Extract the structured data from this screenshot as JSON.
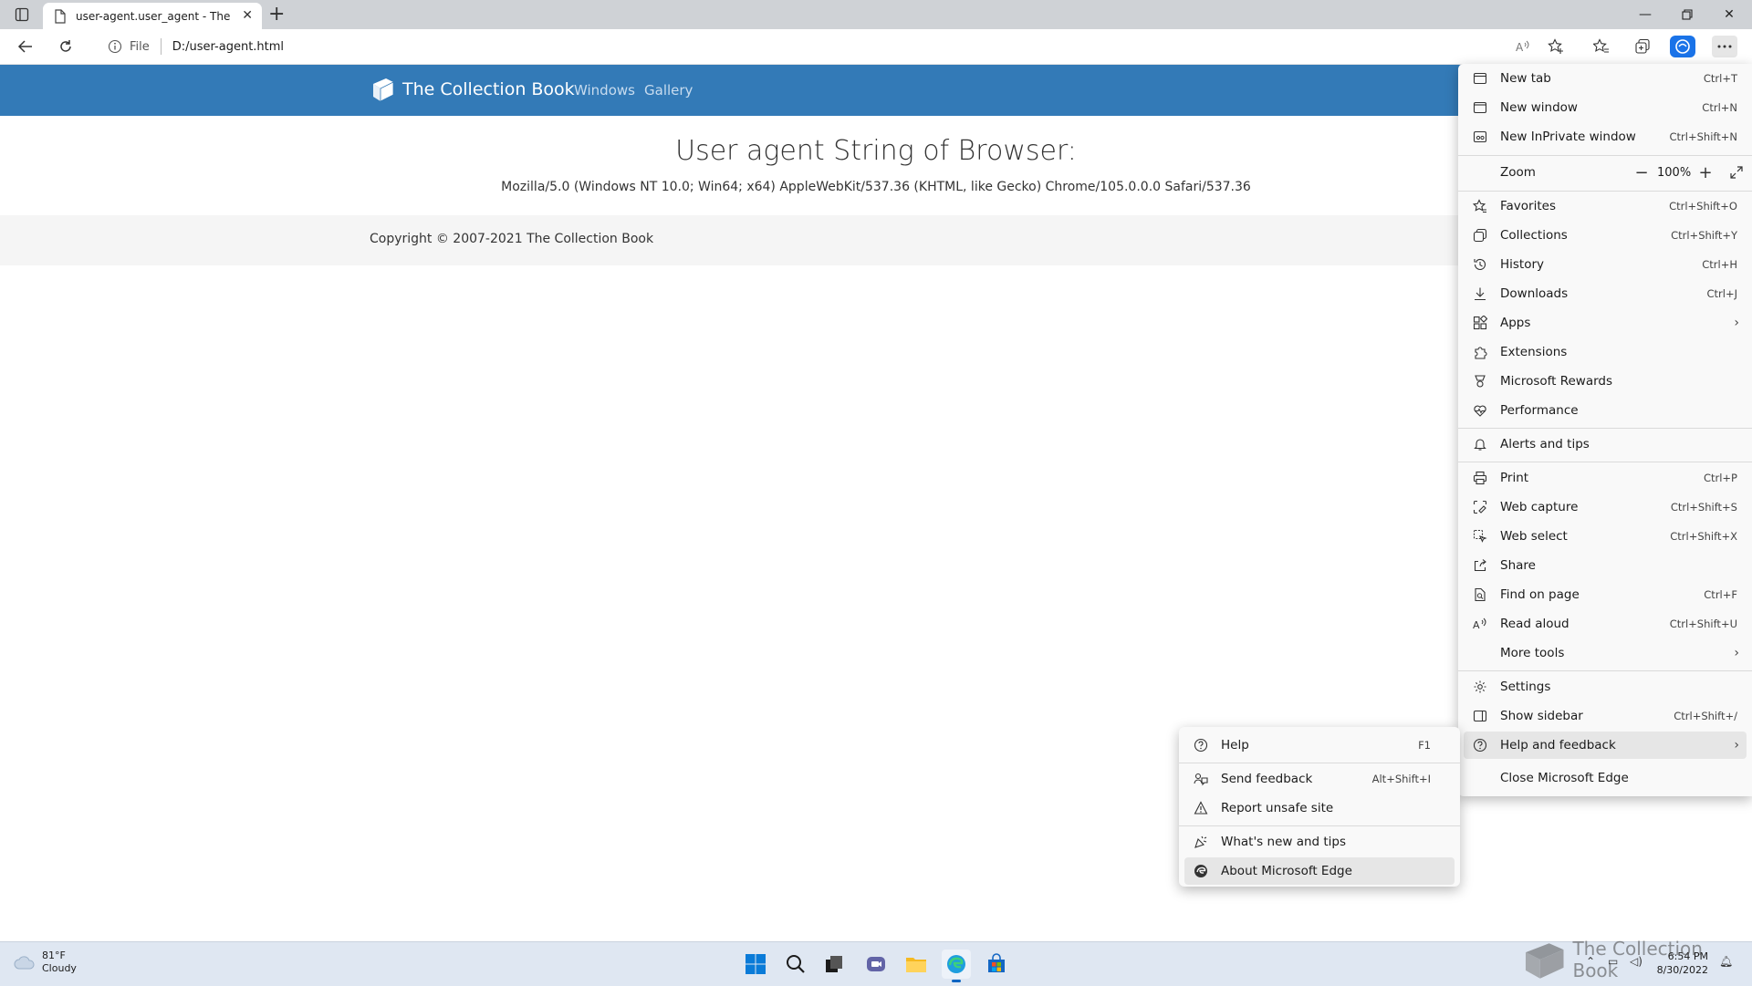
{
  "browser": {
    "tab_title": "user-agent.user_agent - The Coll",
    "address_scheme": "File",
    "address_url": "D:/user-agent.html"
  },
  "page": {
    "brand": "The Collection Book",
    "nav": [
      "Windows",
      "Gallery"
    ],
    "heading": "User agent String of Browser:",
    "user_agent": "Mozilla/5.0 (Windows NT 10.0; Win64; x64) AppleWebKit/537.36 (KHTML, like Gecko) Chrome/105.0.0.0 Safari/537.36",
    "footer": "Copyright © 2007-2021 The Collection Book"
  },
  "menu": {
    "new_tab": {
      "label": "New tab",
      "shortcut": "Ctrl+T"
    },
    "new_window": {
      "label": "New window",
      "shortcut": "Ctrl+N"
    },
    "new_inprivate": {
      "label": "New InPrivate window",
      "shortcut": "Ctrl+Shift+N"
    },
    "zoom": {
      "label": "Zoom",
      "value": "100%"
    },
    "favorites": {
      "label": "Favorites",
      "shortcut": "Ctrl+Shift+O"
    },
    "collections": {
      "label": "Collections",
      "shortcut": "Ctrl+Shift+Y"
    },
    "history": {
      "label": "History",
      "shortcut": "Ctrl+H"
    },
    "downloads": {
      "label": "Downloads",
      "shortcut": "Ctrl+J"
    },
    "apps": {
      "label": "Apps"
    },
    "extensions": {
      "label": "Extensions"
    },
    "rewards": {
      "label": "Microsoft Rewards"
    },
    "performance": {
      "label": "Performance"
    },
    "alerts": {
      "label": "Alerts and tips"
    },
    "print": {
      "label": "Print",
      "shortcut": "Ctrl+P"
    },
    "web_capture": {
      "label": "Web capture",
      "shortcut": "Ctrl+Shift+S"
    },
    "web_select": {
      "label": "Web select",
      "shortcut": "Ctrl+Shift+X"
    },
    "share": {
      "label": "Share"
    },
    "find": {
      "label": "Find on page",
      "shortcut": "Ctrl+F"
    },
    "read_aloud": {
      "label": "Read aloud",
      "shortcut": "Ctrl+Shift+U"
    },
    "more_tools": {
      "label": "More tools"
    },
    "settings": {
      "label": "Settings"
    },
    "show_sidebar": {
      "label": "Show sidebar",
      "shortcut": "Ctrl+Shift+/"
    },
    "help_feedback": {
      "label": "Help and feedback"
    },
    "close_edge": {
      "label": "Close Microsoft Edge"
    }
  },
  "submenu": {
    "help": {
      "label": "Help",
      "shortcut": "F1"
    },
    "send_feedback": {
      "label": "Send feedback",
      "shortcut": "Alt+Shift+I"
    },
    "report_unsafe": {
      "label": "Report unsafe site"
    },
    "whats_new": {
      "label": "What's new and tips"
    },
    "about": {
      "label": "About Microsoft Edge"
    }
  },
  "taskbar": {
    "temp": "81°F",
    "condition": "Cloudy",
    "time": "6:54 PM",
    "date": "8/30/2022",
    "watermark": "The Collection Book"
  },
  "colors": {
    "navbar": "#337ab7",
    "menu_bg": "#f9f9f9",
    "menu_highlight": "#e6e6e6",
    "taskbar": "#dfe7f2"
  }
}
